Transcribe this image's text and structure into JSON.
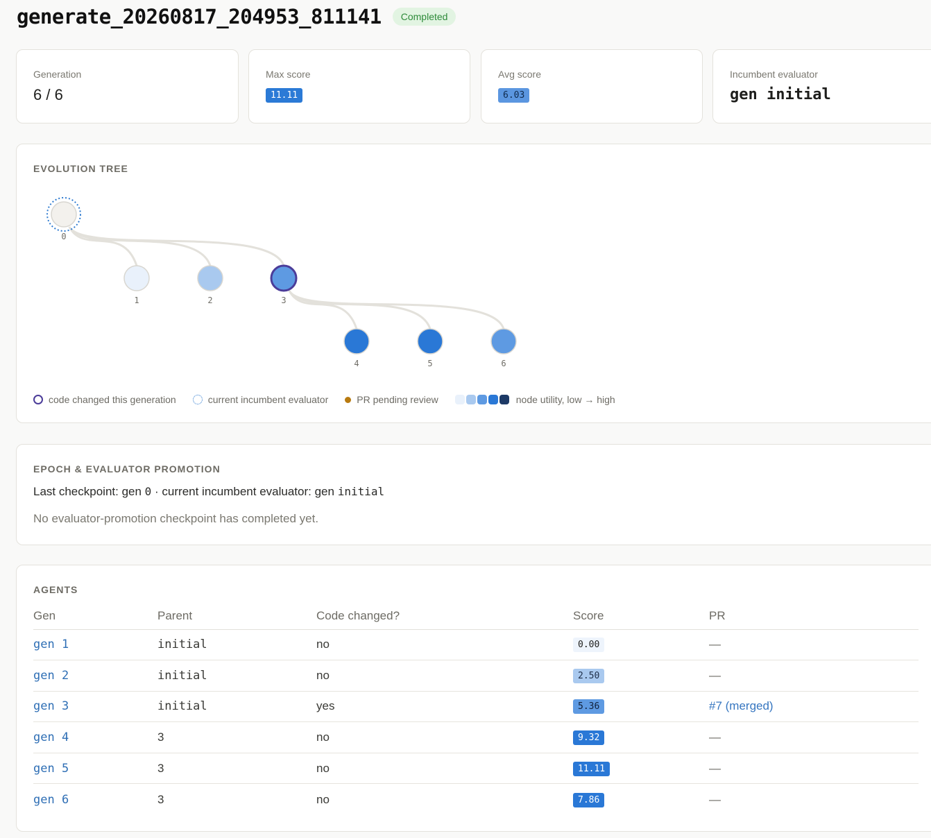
{
  "header": {
    "run_id": "generate_20260817_204953_811141",
    "status": "Completed"
  },
  "stats": {
    "generation": {
      "label": "Generation",
      "value": "6 / 6"
    },
    "max_score": {
      "label": "Max score",
      "value": "11.11",
      "color": "#2b7ad6"
    },
    "avg_score": {
      "label": "Avg score",
      "value": "6.03",
      "color": "#5b96e0"
    },
    "incumbent": {
      "label": "Incumbent evaluator",
      "value": "gen initial"
    }
  },
  "tree": {
    "title": "EVOLUTION TREE",
    "nodes": [
      {
        "id": "0",
        "parent": null,
        "color": "#f3f1ed",
        "incumbent": true,
        "code_changed": false
      },
      {
        "id": "1",
        "parent": "0",
        "color": "#e9f1fb",
        "incumbent": false,
        "code_changed": false
      },
      {
        "id": "2",
        "parent": "0",
        "color": "#a9c9ef",
        "incumbent": false,
        "code_changed": false
      },
      {
        "id": "3",
        "parent": "0",
        "color": "#5e9ae2",
        "incumbent": false,
        "code_changed": true
      },
      {
        "id": "4",
        "parent": "3",
        "color": "#2a78d6",
        "incumbent": false,
        "code_changed": false
      },
      {
        "id": "5",
        "parent": "3",
        "color": "#2a78d6",
        "incumbent": false,
        "code_changed": false
      },
      {
        "id": "6",
        "parent": "3",
        "color": "#5e9ae2",
        "incumbent": false,
        "code_changed": false
      }
    ],
    "legend": {
      "code_changed": "code changed this generation",
      "incumbent": "current incumbent evaluator",
      "pr_pending": "PR pending review",
      "utility": "node utility, low → high",
      "utility_scale": [
        "#e9f1fb",
        "#a9c9ef",
        "#5e9ae2",
        "#2a78d6",
        "#1d3a66"
      ]
    }
  },
  "epoch": {
    "title": "EPOCH & EVALUATOR PROMOTION",
    "line_prefix": "Last checkpoint: gen ",
    "checkpoint_gen": "0",
    "line_mid": " · current incumbent evaluator: gen ",
    "incumbent": "initial",
    "note": "No evaluator-promotion checkpoint has completed yet."
  },
  "agents": {
    "title": "AGENTS",
    "columns": [
      "Gen",
      "Parent",
      "Code changed?",
      "Score",
      "PR"
    ],
    "rows": [
      {
        "gen": "gen 1",
        "parent": "initial",
        "code_changed": "no",
        "score": "0.00",
        "score_bg": "#eef4fc",
        "score_fg": "#1e1e1c",
        "pr": "—",
        "pr_is_link": false
      },
      {
        "gen": "gen 2",
        "parent": "initial",
        "code_changed": "no",
        "score": "2.50",
        "score_bg": "#a9c9ef",
        "score_fg": "#1e2e48",
        "pr": "—",
        "pr_is_link": false
      },
      {
        "gen": "gen 3",
        "parent": "initial",
        "code_changed": "yes",
        "score": "5.36",
        "score_bg": "#5e9ae2",
        "score_fg": "#10203a",
        "pr": "#7 (merged)",
        "pr_is_link": true
      },
      {
        "gen": "gen 4",
        "parent": "3",
        "code_changed": "no",
        "score": "9.32",
        "score_bg": "#2a78d6",
        "score_fg": "#ffffff",
        "pr": "—",
        "pr_is_link": false
      },
      {
        "gen": "gen 5",
        "parent": "3",
        "code_changed": "no",
        "score": "11.11",
        "score_bg": "#2a78d6",
        "score_fg": "#ffffff",
        "pr": "—",
        "pr_is_link": false
      },
      {
        "gen": "gen 6",
        "parent": "3",
        "code_changed": "no",
        "score": "7.86",
        "score_bg": "#2a78d6",
        "score_fg": "#ffffff",
        "pr": "—",
        "pr_is_link": false
      }
    ]
  }
}
